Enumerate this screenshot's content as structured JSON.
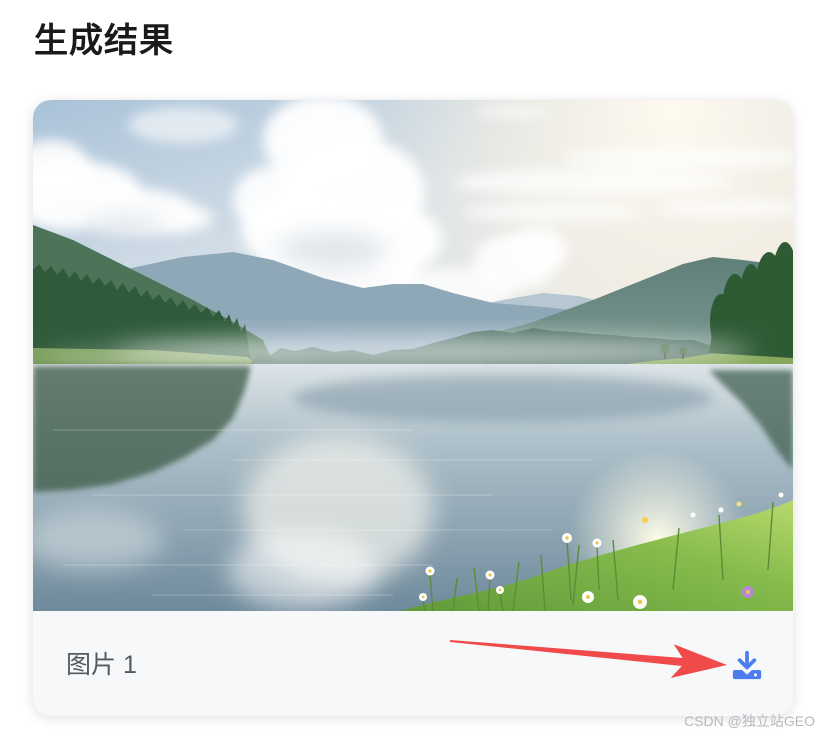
{
  "page": {
    "title": "生成结果"
  },
  "result_card": {
    "label": "图片 1",
    "download_icon": "download-icon"
  },
  "annotation": {
    "icon": "red-arrow"
  },
  "watermark": {
    "text": "CSDN @独立站GEO"
  },
  "colors": {
    "title": "#1a1a1a",
    "accent": "#4b7cf0",
    "annotation_arrow": "#f04a4a",
    "footer_background": "#f7f8fa",
    "label": "#555a60"
  }
}
